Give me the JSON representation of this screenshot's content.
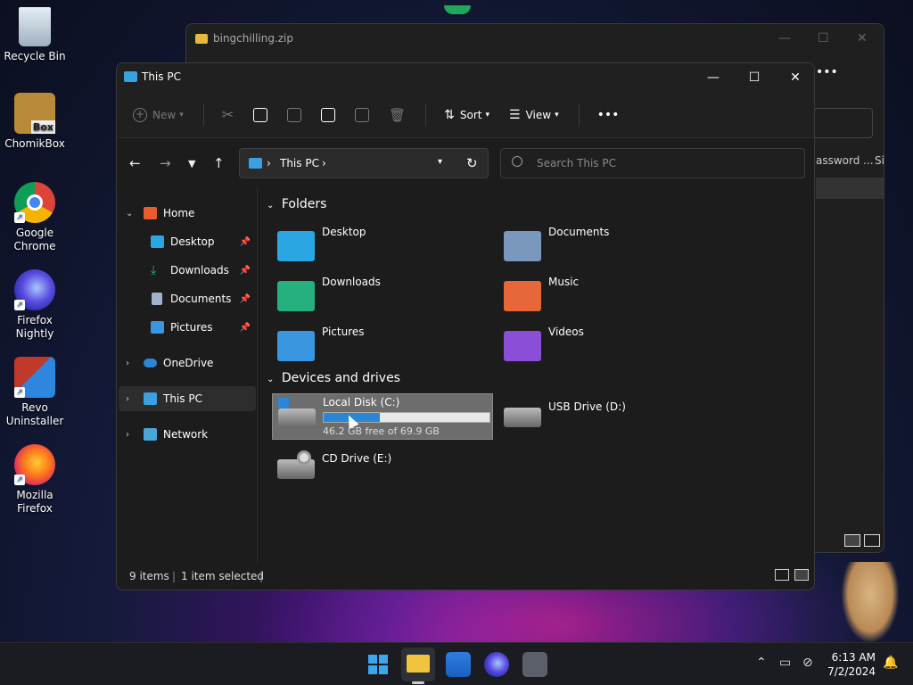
{
  "desktop": {
    "icons": [
      {
        "label": "Recycle Bin",
        "icon": "recycle-bin-icon"
      },
      {
        "label": "ChomikBox",
        "icon": "chomikbox-icon",
        "badge": "Box"
      },
      {
        "label": "Google Chrome",
        "icon": "chrome-icon"
      },
      {
        "label": "Firefox Nightly",
        "icon": "firefox-nightly-icon"
      },
      {
        "label": "Revo Uninstaller",
        "icon": "revo-uninstaller-icon"
      },
      {
        "label": "Mozilla Firefox",
        "icon": "firefox-icon"
      }
    ]
  },
  "zip_window": {
    "title": "bingchilling.zip",
    "partial_columns": [
      "assword ...",
      "Si"
    ]
  },
  "explorer": {
    "title": "This PC",
    "toolbar": {
      "new": "New",
      "sort": "Sort",
      "view": "View",
      "more": "•••"
    },
    "address": {
      "root": "This PC"
    },
    "search": {
      "placeholder": "Search This PC"
    },
    "sidebar": {
      "home": "Home",
      "items": [
        {
          "label": "Desktop",
          "pinned": true
        },
        {
          "label": "Downloads",
          "pinned": true
        },
        {
          "label": "Documents",
          "pinned": true
        },
        {
          "label": "Pictures",
          "pinned": true
        }
      ],
      "onedrive": "OneDrive",
      "thispc": "This PC",
      "network": "Network"
    },
    "sections": {
      "folders": "Folders",
      "devices": "Devices and drives"
    },
    "folders": [
      {
        "label": "Desktop",
        "color": "#2aa7e3"
      },
      {
        "label": "Documents",
        "color": "#7a98bd"
      },
      {
        "label": "Downloads",
        "color": "#26b07d"
      },
      {
        "label": "Music",
        "color": "#e8673a"
      },
      {
        "label": "Pictures",
        "color": "#3b96e0"
      },
      {
        "label": "Videos",
        "color": "#8a4fd6"
      }
    ],
    "drives": [
      {
        "label": "Local Disk (C:)",
        "free_text": "46.2 GB free of 69.9 GB",
        "used_fraction": 0.34,
        "selected": true
      },
      {
        "label": "USB Drive (D:)"
      },
      {
        "label": "CD Drive (E:)"
      }
    ],
    "status": {
      "items": "9 items",
      "selected": "1 item selected"
    }
  },
  "taskbar": {
    "clock_time": "6:13 AM",
    "clock_date": "7/2/2024"
  }
}
